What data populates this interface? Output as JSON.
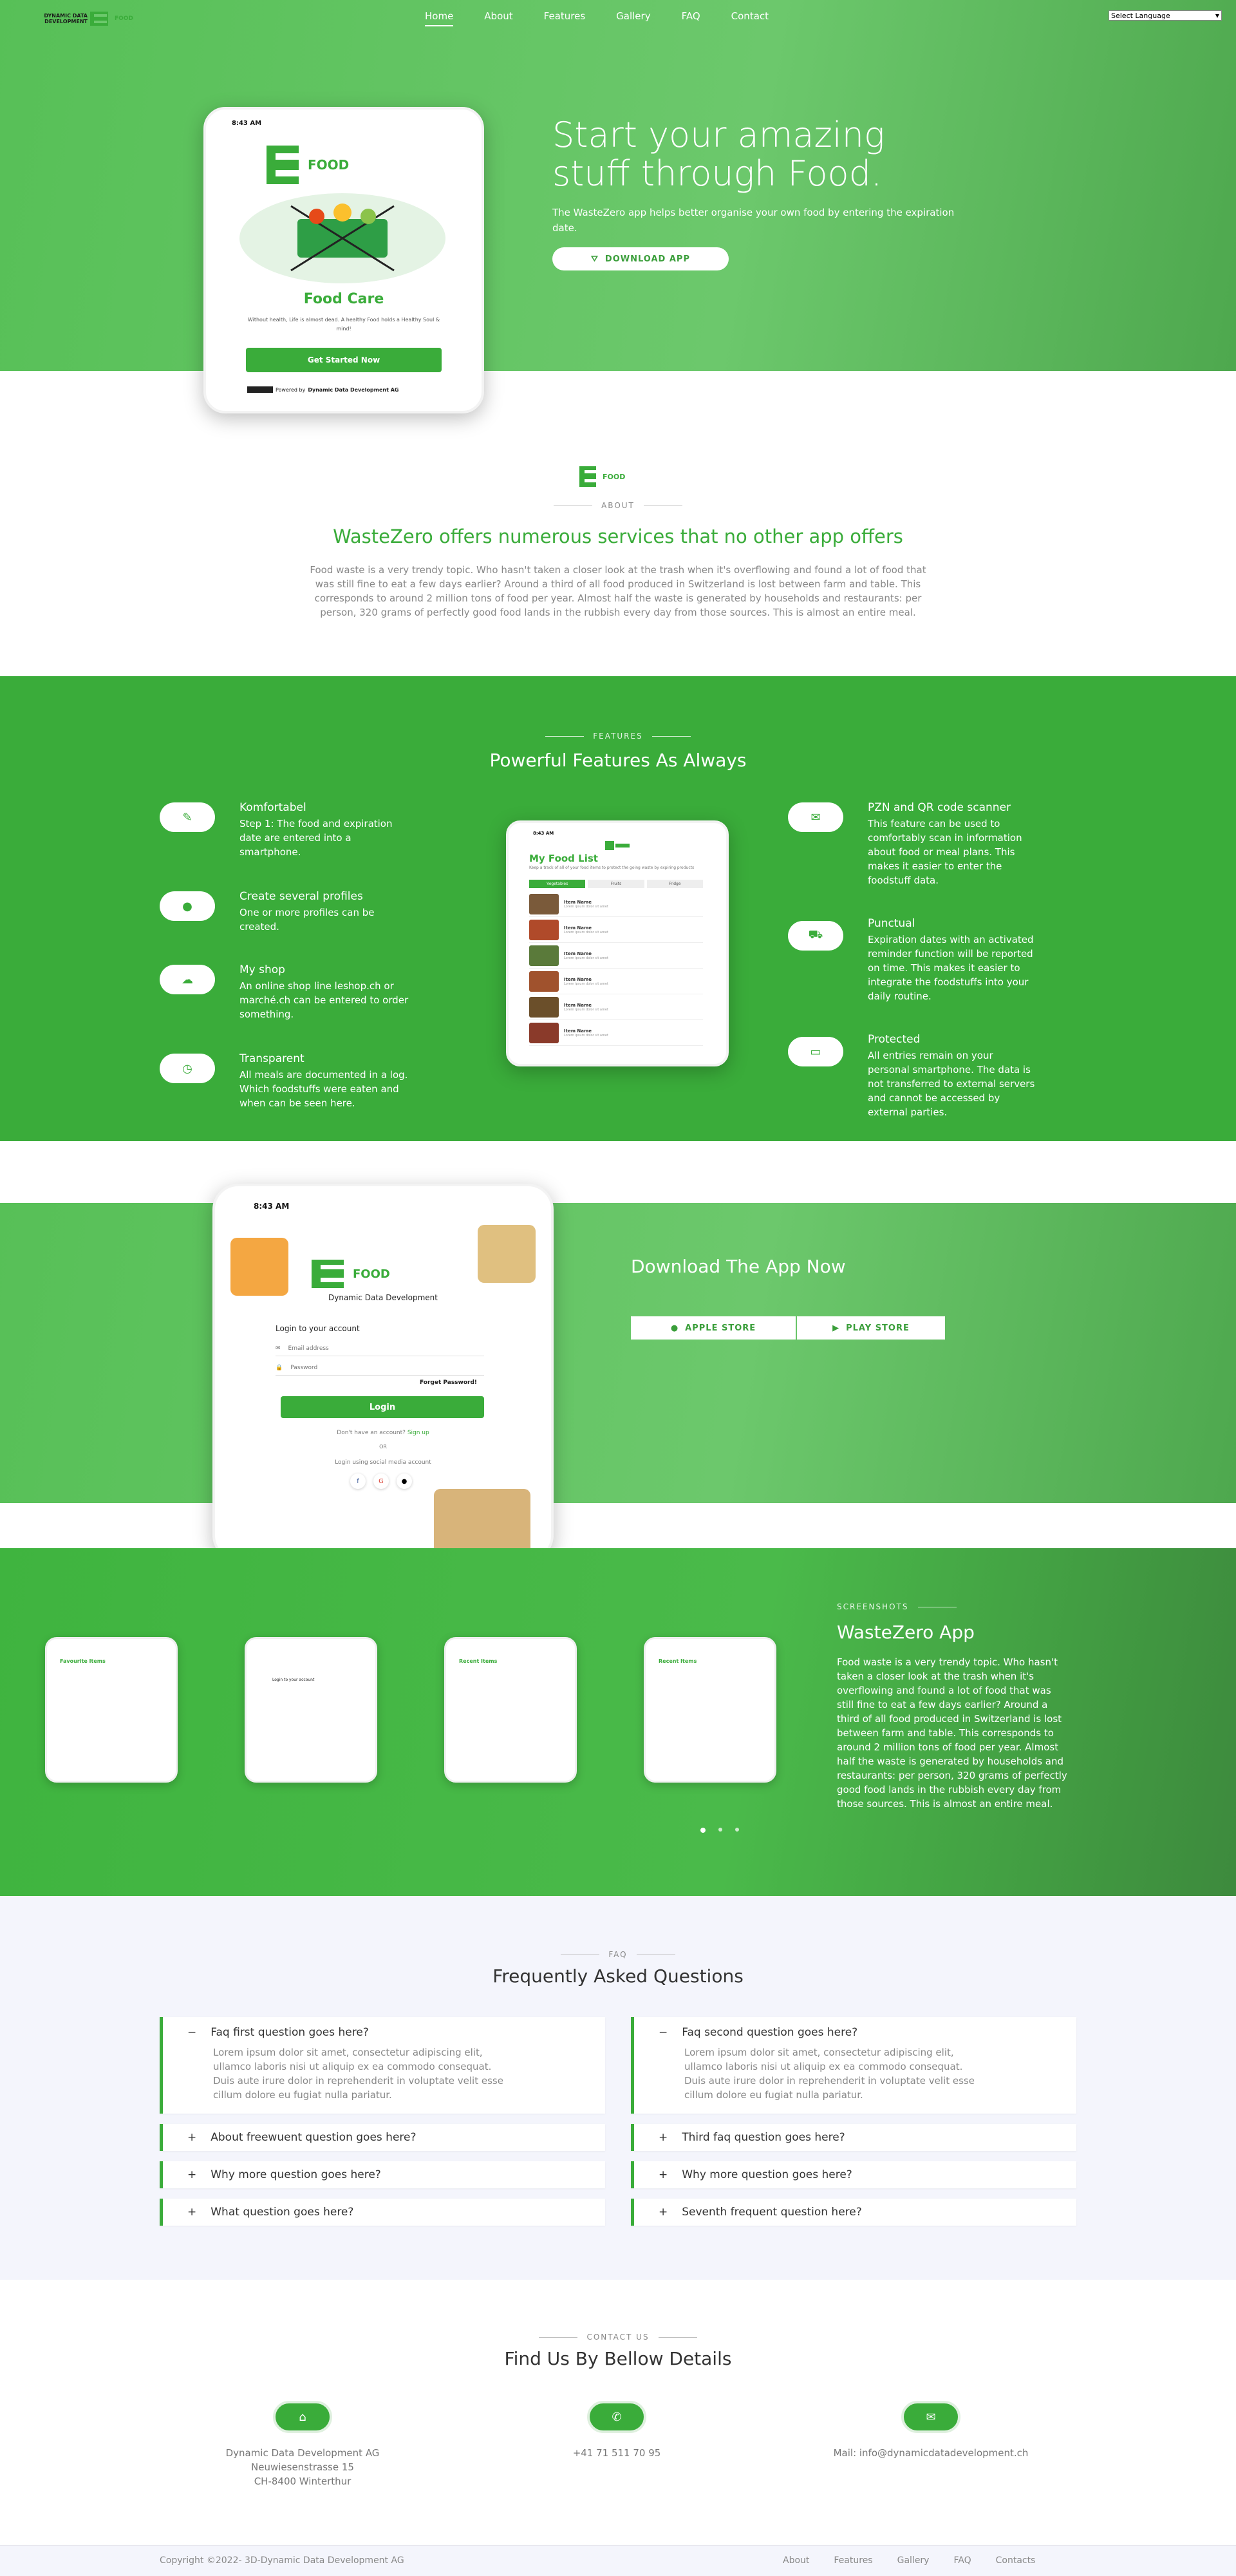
{
  "nav": {
    "logo_text": "DYNAMIC DATA DEVELOPMENT",
    "logo_word": "FOOD",
    "links": [
      "Home",
      "About",
      "Features",
      "Gallery",
      "FAQ",
      "Contact"
    ],
    "language": "Select Language"
  },
  "hero": {
    "title_line1": "Start your amazing",
    "title_line2": "stuff through Food.",
    "desc_line1": "The WasteZero app helps better organise your own food by entering the expiration",
    "desc_line2": "date.",
    "download_btn": "DOWNLOAD APP",
    "phone": {
      "time": "8:43 AM",
      "logo_word": "FOOD",
      "heading": "Food Care",
      "tagline": "Without health, Life is almost dead. A healthy Food holds a Healthy Soul & mind!",
      "cta": "Get Started Now",
      "powered": "Powered by",
      "powered_company": "Dynamic Data Development AG"
    }
  },
  "about": {
    "logo_word": "FOOD",
    "label": "ABOUT",
    "title": "WasteZero offers numerous services that no other app offers",
    "lines": [
      "Food waste is a very trendy topic. Who hasn't taken a closer look at the trash when it's overflowing and found a lot of food that",
      "was still fine to eat a few days earlier? Around a third of all food produced in Switzerland is lost between farm and table. This",
      "corresponds to around 2 million tons of food per year. Almost half the waste is generated by households and restaurants: per",
      "person, 320 grams of perfectly good food lands in the rubbish every day from those sources. This is almost an entire meal."
    ]
  },
  "features": {
    "label": "FEATURES",
    "title": "Powerful Features As Always",
    "left": [
      {
        "title": "Komfortabel",
        "lines": [
          "Step 1: The food and expiration",
          "date are entered into a",
          "smartphone."
        ],
        "icon": "utensils-icon"
      },
      {
        "title": "Create several profiles",
        "lines": [
          "One or more profiles can be",
          "created."
        ],
        "icon": "microphone-icon"
      },
      {
        "title": "My shop",
        "lines": [
          "An online shop line leshop.ch or",
          "marché.ch can be entered to order",
          "something."
        ],
        "icon": "cloud-icon"
      },
      {
        "title": "Transparent",
        "lines": [
          "All meals are documented in a log.",
          "Which foodstuffs were eaten and",
          "when can be seen here."
        ],
        "icon": "clock-icon"
      }
    ],
    "right": [
      {
        "title": "PZN and QR code scanner",
        "lines": [
          "This feature can be used to",
          "comfortably scan in information",
          "about food or meal plans. This",
          "makes it easier to enter the",
          "foodstuff data."
        ],
        "icon": "envelope-icon"
      },
      {
        "title": "Punctual",
        "lines": [
          "Expiration dates with an activated",
          "reminder function will be reported",
          "on time. This makes it easier to",
          "integrate the foodstuffs into your",
          "daily routine."
        ],
        "icon": "truck-icon"
      },
      {
        "title": "Protected",
        "lines": [
          "All entries remain on your",
          "personal smartphone. The data is",
          "not transferred to external servers",
          "and cannot be accessed by",
          "external parties."
        ],
        "icon": "card-icon"
      }
    ],
    "phone": {
      "time": "8:43 AM",
      "title": "My Food List",
      "subtitle": "Keep a track of all of your food items to protect the going waste by expiring products",
      "tabs": [
        "Vegetables",
        "Fruits",
        "Fridge"
      ],
      "item_name": "Item Name",
      "item_detail": "Lorem ipsum dolor sit amet"
    }
  },
  "download": {
    "title": "Download The App Now",
    "apple": "APPLE STORE",
    "play": "PLAY STORE",
    "phone": {
      "time": "8:43 AM",
      "logo_word": "FOOD",
      "company": "Dynamic Data Development",
      "login_title": "Login to your account",
      "email": "Email address",
      "password": "Password",
      "forgot": "Forget Password!",
      "login_btn": "Login",
      "no_account": "Don't have an account?",
      "signup": "Sign up",
      "or": "OR",
      "social": "Login using social media account"
    }
  },
  "screenshots": {
    "label": "SCREENSHOTS",
    "title": "WasteZero App",
    "lines": [
      "Food waste is a very trendy topic. Who hasn't",
      "taken a closer look at the trash when it's",
      "overflowing and found a lot of food that was",
      "still fine to eat a few days earlier? Around a",
      "third of all food produced in Switzerland is lost",
      "between farm and table. This corresponds to",
      "around 2 million tons of food per year. Almost",
      "half the waste is generated by households and",
      "restaurants: per person, 320 grams of perfectly",
      "good food lands in the rubbish every day from",
      "those sources. This is almost an entire meal."
    ],
    "phones": [
      {
        "title": "Favourite Items"
      },
      {
        "title": "Login to your account"
      },
      {
        "title": "Recent Items"
      },
      {
        "title": "Recent Items"
      }
    ]
  },
  "faq": {
    "label": "FAQ",
    "title": "Frequently Asked Questions",
    "answer_lines": [
      "Lorem ipsum dolor sit amet, consectetur adipiscing elit,",
      "ullamco laboris nisi ut aliquip ex ea commodo consequat.",
      "Duis aute irure dolor in reprehenderit in voluptate velit esse",
      "cillum dolore eu fugiat nulla pariatur."
    ],
    "left": [
      "Faq first question goes here?",
      "About freewuent question goes here?",
      "Why more question goes here?",
      "What question goes here?"
    ],
    "right": [
      "Faq second question goes here?",
      "Third faq question goes here?",
      "Why more question goes here?",
      "Seventh frequent question here?"
    ]
  },
  "contact": {
    "label": "CONTACT US",
    "title": "Find Us By Bellow Details",
    "address": [
      "Dynamic Data Development AG",
      "Neuwiesenstrasse 15",
      "CH-8400 Winterthur"
    ],
    "phone": "+41 71 511 70 95",
    "mail": "Mail: info@dynamicdatadevelopment.ch"
  },
  "footer": {
    "copyright": "Copyright ©2022- 3D-Dynamic Data Development AG",
    "links": [
      "About",
      "Features",
      "Gallery",
      "FAQ",
      "Contacts"
    ]
  },
  "colors": {
    "primary": "#3aac3a",
    "hero": "#6cc86c"
  }
}
